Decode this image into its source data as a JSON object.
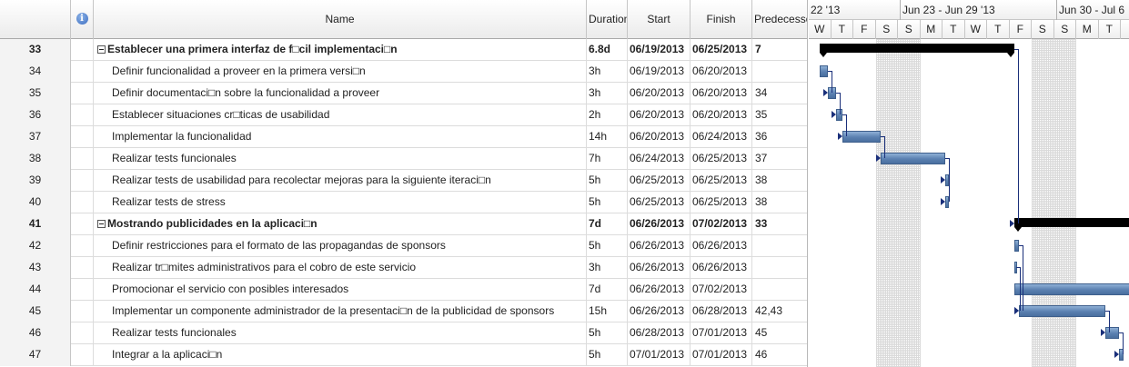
{
  "columns": {
    "info_icon": "info-icon",
    "name": "Name",
    "duration": "Duration",
    "start": "Start",
    "finish": "Finish",
    "predecessors": "Predecessors"
  },
  "timescale": {
    "weeks": [
      "22 '13",
      "Jun 23 - Jun 29 '13",
      "Jun 30 - Jul 6"
    ],
    "days": [
      "W",
      "T",
      "F",
      "S",
      "S",
      "M",
      "T",
      "W",
      "T",
      "F",
      "S",
      "S",
      "M",
      "T"
    ]
  },
  "colors": {
    "task_bar": "#5a80b0",
    "summary_bar": "#000000",
    "link": "#1a2f7a"
  },
  "tasks": [
    {
      "id": "33",
      "name": "Establecer una primera interfaz de f□cil implementaci□n",
      "duration": "6.8d",
      "start": "06/19/2013",
      "finish": "06/25/2013",
      "pred": "7",
      "summary": true
    },
    {
      "id": "34",
      "name": "Definir funcionalidad a proveer en la primera versi□n",
      "duration": "3h",
      "start": "06/19/2013",
      "finish": "06/20/2013",
      "pred": "",
      "summary": false
    },
    {
      "id": "35",
      "name": "Definir documentaci□n sobre la funcionalidad a proveer",
      "duration": "3h",
      "start": "06/20/2013",
      "finish": "06/20/2013",
      "pred": "34",
      "summary": false
    },
    {
      "id": "36",
      "name": "Establecer situaciones cr□ticas de usabilidad",
      "duration": "2h",
      "start": "06/20/2013",
      "finish": "06/20/2013",
      "pred": "35",
      "summary": false
    },
    {
      "id": "37",
      "name": "Implementar la funcionalidad",
      "duration": "14h",
      "start": "06/20/2013",
      "finish": "06/24/2013",
      "pred": "36",
      "summary": false
    },
    {
      "id": "38",
      "name": "Realizar tests funcionales",
      "duration": "7h",
      "start": "06/24/2013",
      "finish": "06/25/2013",
      "pred": "37",
      "summary": false
    },
    {
      "id": "39",
      "name": "Realizar tests de usabilidad para recolectar mejoras para la siguiente iteraci□n",
      "duration": "5h",
      "start": "06/25/2013",
      "finish": "06/25/2013",
      "pred": "38",
      "summary": false
    },
    {
      "id": "40",
      "name": "Realizar tests de stress",
      "duration": "5h",
      "start": "06/25/2013",
      "finish": "06/25/2013",
      "pred": "38",
      "summary": false
    },
    {
      "id": "41",
      "name": "Mostrando publicidades en la aplicaci□n",
      "duration": "7d",
      "start": "06/26/2013",
      "finish": "07/02/2013",
      "pred": "33",
      "summary": true
    },
    {
      "id": "42",
      "name": "Definir restricciones para el formato de las propagandas de sponsors",
      "duration": "5h",
      "start": "06/26/2013",
      "finish": "06/26/2013",
      "pred": "",
      "summary": false
    },
    {
      "id": "43",
      "name": "Realizar tr□mites administrativos para el cobro de este servicio",
      "duration": "3h",
      "start": "06/26/2013",
      "finish": "06/26/2013",
      "pred": "",
      "summary": false
    },
    {
      "id": "44",
      "name": "Promocionar el servicio con posibles interesados",
      "duration": "7d",
      "start": "06/26/2013",
      "finish": "07/02/2013",
      "pred": "",
      "summary": false
    },
    {
      "id": "45",
      "name": "Implementar un componente administrador de la presentaci□n de la publicidad de sponsors",
      "duration": "15h",
      "start": "06/26/2013",
      "finish": "06/28/2013",
      "pred": "42,43",
      "summary": false
    },
    {
      "id": "46",
      "name": "Realizar tests funcionales",
      "duration": "5h",
      "start": "06/28/2013",
      "finish": "07/01/2013",
      "pred": "45",
      "summary": false
    },
    {
      "id": "47",
      "name": "Integrar a la aplicaci□n",
      "duration": "5h",
      "start": "07/01/2013",
      "finish": "07/01/2013",
      "pred": "46",
      "summary": false
    }
  ]
}
